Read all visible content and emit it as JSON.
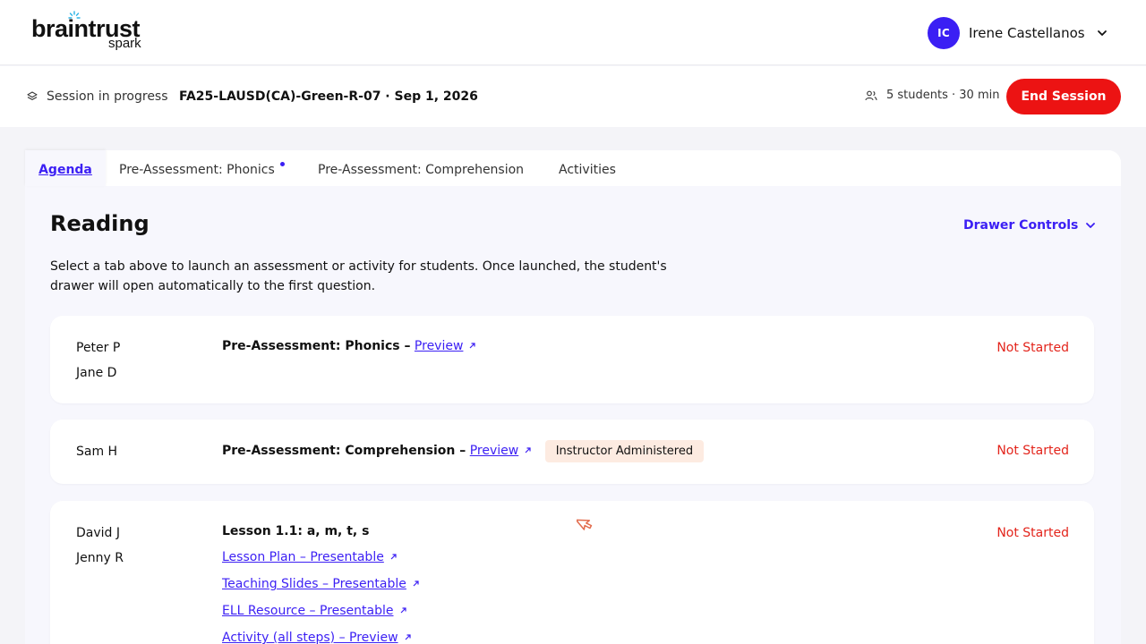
{
  "brand": {
    "name": "braintrust",
    "product": "spark",
    "colors": {
      "accent": "#3b1ff4",
      "danger": "#ec1313",
      "status_not_started": "#e3241b",
      "badge_bg": "#fdebe1"
    }
  },
  "user": {
    "initials": "IC",
    "name": "Irene Castellanos"
  },
  "session": {
    "status": "Session in progress",
    "name": "FA25-LAUSD(CA)-Green-R-07 · Sep 1, 2026",
    "meta": "5 students · 30 min",
    "end_label": "End Session"
  },
  "tabs": [
    {
      "label": "Agenda",
      "active": true
    },
    {
      "label": "Pre-Assessment: Phonics",
      "has_dot": true
    },
    {
      "label": "Pre-Assessment: Comprehension"
    },
    {
      "label": "Activities"
    }
  ],
  "panel": {
    "title": "Reading",
    "drawer_controls": "Drawer Controls",
    "description": "Select a tab above to launch an assessment or activity for students. Once launched, the student's drawer will open automatically to the first question."
  },
  "cards": [
    {
      "students": [
        "Peter P",
        "Jane D"
      ],
      "title": "Pre-Assessment: Phonics –",
      "link": "Preview",
      "status": "Not Started"
    },
    {
      "students": [
        "Sam H"
      ],
      "title": "Pre-Assessment: Comprehension –",
      "link": "Preview",
      "badge": "Instructor Administered",
      "status": "Not Started"
    },
    {
      "students": [
        "David J",
        "Jenny R"
      ],
      "title": "Lesson 1.1: a, m, t, s",
      "links": [
        "Lesson Plan – Presentable",
        "Teaching Slides – Presentable",
        "ELL Resource – Presentable",
        "Activity (all steps) – Preview"
      ],
      "status": "Not Started"
    }
  ]
}
